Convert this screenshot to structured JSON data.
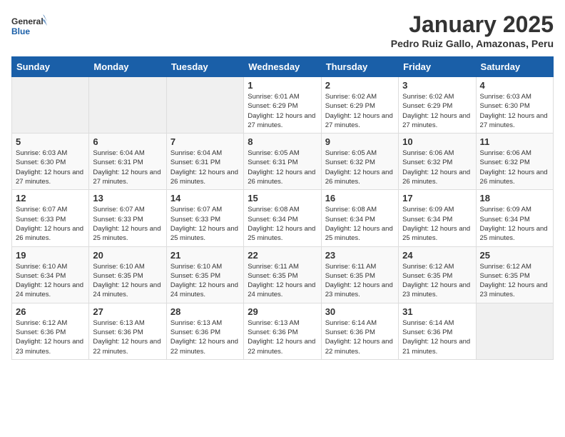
{
  "logo": {
    "general": "General",
    "blue": "Blue"
  },
  "header": {
    "title": "January 2025",
    "subtitle": "Pedro Ruiz Gallo, Amazonas, Peru"
  },
  "weekdays": [
    "Sunday",
    "Monday",
    "Tuesday",
    "Wednesday",
    "Thursday",
    "Friday",
    "Saturday"
  ],
  "weeks": [
    [
      {
        "day": "",
        "empty": true
      },
      {
        "day": "",
        "empty": true
      },
      {
        "day": "",
        "empty": true
      },
      {
        "day": "1",
        "sunrise": "6:01 AM",
        "sunset": "6:29 PM",
        "daylight": "12 hours and 27 minutes."
      },
      {
        "day": "2",
        "sunrise": "6:02 AM",
        "sunset": "6:29 PM",
        "daylight": "12 hours and 27 minutes."
      },
      {
        "day": "3",
        "sunrise": "6:02 AM",
        "sunset": "6:29 PM",
        "daylight": "12 hours and 27 minutes."
      },
      {
        "day": "4",
        "sunrise": "6:03 AM",
        "sunset": "6:30 PM",
        "daylight": "12 hours and 27 minutes."
      }
    ],
    [
      {
        "day": "5",
        "sunrise": "6:03 AM",
        "sunset": "6:30 PM",
        "daylight": "12 hours and 27 minutes."
      },
      {
        "day": "6",
        "sunrise": "6:04 AM",
        "sunset": "6:31 PM",
        "daylight": "12 hours and 27 minutes."
      },
      {
        "day": "7",
        "sunrise": "6:04 AM",
        "sunset": "6:31 PM",
        "daylight": "12 hours and 26 minutes."
      },
      {
        "day": "8",
        "sunrise": "6:05 AM",
        "sunset": "6:31 PM",
        "daylight": "12 hours and 26 minutes."
      },
      {
        "day": "9",
        "sunrise": "6:05 AM",
        "sunset": "6:32 PM",
        "daylight": "12 hours and 26 minutes."
      },
      {
        "day": "10",
        "sunrise": "6:06 AM",
        "sunset": "6:32 PM",
        "daylight": "12 hours and 26 minutes."
      },
      {
        "day": "11",
        "sunrise": "6:06 AM",
        "sunset": "6:32 PM",
        "daylight": "12 hours and 26 minutes."
      }
    ],
    [
      {
        "day": "12",
        "sunrise": "6:07 AM",
        "sunset": "6:33 PM",
        "daylight": "12 hours and 26 minutes."
      },
      {
        "day": "13",
        "sunrise": "6:07 AM",
        "sunset": "6:33 PM",
        "daylight": "12 hours and 25 minutes."
      },
      {
        "day": "14",
        "sunrise": "6:07 AM",
        "sunset": "6:33 PM",
        "daylight": "12 hours and 25 minutes."
      },
      {
        "day": "15",
        "sunrise": "6:08 AM",
        "sunset": "6:34 PM",
        "daylight": "12 hours and 25 minutes."
      },
      {
        "day": "16",
        "sunrise": "6:08 AM",
        "sunset": "6:34 PM",
        "daylight": "12 hours and 25 minutes."
      },
      {
        "day": "17",
        "sunrise": "6:09 AM",
        "sunset": "6:34 PM",
        "daylight": "12 hours and 25 minutes."
      },
      {
        "day": "18",
        "sunrise": "6:09 AM",
        "sunset": "6:34 PM",
        "daylight": "12 hours and 25 minutes."
      }
    ],
    [
      {
        "day": "19",
        "sunrise": "6:10 AM",
        "sunset": "6:34 PM",
        "daylight": "12 hours and 24 minutes."
      },
      {
        "day": "20",
        "sunrise": "6:10 AM",
        "sunset": "6:35 PM",
        "daylight": "12 hours and 24 minutes."
      },
      {
        "day": "21",
        "sunrise": "6:10 AM",
        "sunset": "6:35 PM",
        "daylight": "12 hours and 24 minutes."
      },
      {
        "day": "22",
        "sunrise": "6:11 AM",
        "sunset": "6:35 PM",
        "daylight": "12 hours and 24 minutes."
      },
      {
        "day": "23",
        "sunrise": "6:11 AM",
        "sunset": "6:35 PM",
        "daylight": "12 hours and 23 minutes."
      },
      {
        "day": "24",
        "sunrise": "6:12 AM",
        "sunset": "6:35 PM",
        "daylight": "12 hours and 23 minutes."
      },
      {
        "day": "25",
        "sunrise": "6:12 AM",
        "sunset": "6:35 PM",
        "daylight": "12 hours and 23 minutes."
      }
    ],
    [
      {
        "day": "26",
        "sunrise": "6:12 AM",
        "sunset": "6:36 PM",
        "daylight": "12 hours and 23 minutes."
      },
      {
        "day": "27",
        "sunrise": "6:13 AM",
        "sunset": "6:36 PM",
        "daylight": "12 hours and 22 minutes."
      },
      {
        "day": "28",
        "sunrise": "6:13 AM",
        "sunset": "6:36 PM",
        "daylight": "12 hours and 22 minutes."
      },
      {
        "day": "29",
        "sunrise": "6:13 AM",
        "sunset": "6:36 PM",
        "daylight": "12 hours and 22 minutes."
      },
      {
        "day": "30",
        "sunrise": "6:14 AM",
        "sunset": "6:36 PM",
        "daylight": "12 hours and 22 minutes."
      },
      {
        "day": "31",
        "sunrise": "6:14 AM",
        "sunset": "6:36 PM",
        "daylight": "12 hours and 21 minutes."
      },
      {
        "day": "",
        "empty": true
      }
    ]
  ],
  "labels": {
    "sunrise": "Sunrise:",
    "sunset": "Sunset:",
    "daylight": "Daylight:"
  }
}
